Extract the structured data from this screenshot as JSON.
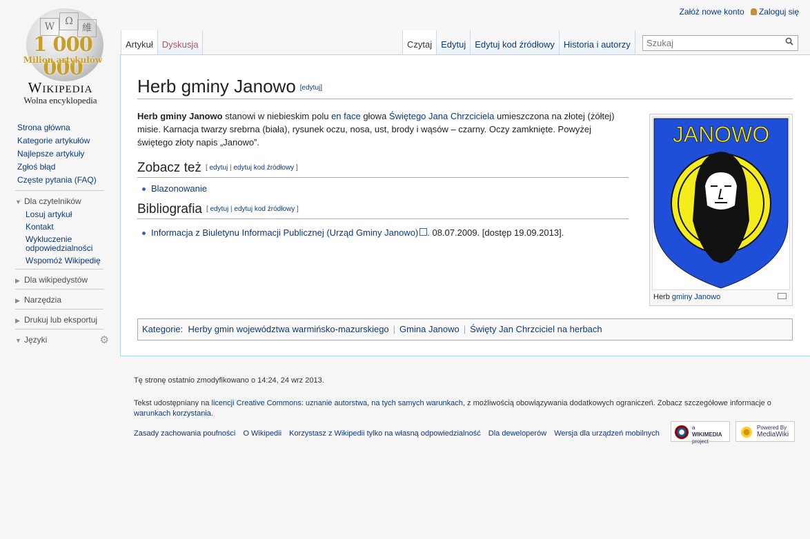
{
  "logo": {
    "million_number": "1 000 000",
    "million_text": "Milion artykułów",
    "wordmark": "Wikipedia",
    "slogan": "Wolna encyklopedia"
  },
  "personal": {
    "create_account": "Załóż nowe konto",
    "login": "Zaloguj się"
  },
  "left_tabs": [
    {
      "label": "Artykuł",
      "selected": true
    },
    {
      "label": "Dyskusja",
      "selected": false
    }
  ],
  "right_tabs": [
    {
      "label": "Czytaj",
      "selected": true
    },
    {
      "label": "Edytuj"
    },
    {
      "label": "Edytuj kod źródłowy"
    },
    {
      "label": "Historia i autorzy"
    }
  ],
  "search": {
    "placeholder": "Szukaj"
  },
  "sidebar": {
    "main": [
      "Strona główna",
      "Kategorie artykułów",
      "Najlepsze artykuły",
      "Zgłoś błąd",
      "Częste pytania (FAQ)"
    ],
    "readers": {
      "title": "Dla czytelników",
      "items": [
        "Losuj artykuł",
        "Kontakt",
        "Wykluczenie odpowiedzialności",
        "Wspomóż Wikipedię"
      ]
    },
    "wikipedians": "Dla wikipedystów",
    "tools": "Narzędzia",
    "print": "Drukuj lub eksportuj",
    "languages": "Języki"
  },
  "article": {
    "title": "Herb gminy Janowo",
    "edit": "[edytuj]",
    "intro_bold": "Herb gminy Janowo",
    "intro_1": " stanowi w niebieskim polu ",
    "link_enface": "en face",
    "intro_2": " głowa ",
    "link_saint": "Świętego Jana Chrzciciela",
    "intro_3": " umieszczona na złotej (żółtej) misie. Karnacja twarzy srebrna (biała), rysunek oczu, nosa, ust, brody i wąsów – czarny. Oczy zamknięte. Powyżej świętego złoty napis „Janowo”.",
    "section_edit_open": "[ ",
    "section_edit_a": "edytuj",
    "section_edit_sep": " | ",
    "section_edit_b": "edytuj kod źródłowy",
    "section_edit_close": " ]",
    "see_also": "Zobacz też",
    "see_also_item": "Blazonowanie",
    "bibliography": "Bibliografia",
    "bib_link": "Informacja z Biuletynu Informacji Publicznej (Urząd Gminy Janowo)",
    "bib_rest": ". 08.07.2009. [dostęp 19.09.2013]."
  },
  "thumb": {
    "caption_prefix": "Herb ",
    "caption_link": "gminy Janowo",
    "coat_text": "JANOWO",
    "colors": {
      "shield": "#1f4fd8",
      "disc": "#f5ec1c"
    }
  },
  "categories": {
    "label": "Kategorie",
    "items": [
      "Herby gmin województwa warmińsko-mazurskiego",
      "Gmina Janowo",
      "Święty Jan Chrzciciel na herbach"
    ]
  },
  "footer": {
    "modified": "Tę stronę ostatnio zmodyfikowano o 14:24, 24 wrz 2013.",
    "license_1": "Tekst udostępniany na ",
    "license_link": "licencji Creative Commons: uznanie autorstwa, na tych samych warunkach",
    "license_2": ", z możliwością obowiązywania dodatkowych ograniczeń. Zobacz szczegółowe informacje o ",
    "terms_link": "warunkach korzystania",
    "license_3": ".",
    "links": [
      "Zasady zachowania poufności",
      "O Wikipedii",
      "Korzystasz z Wikipedii tylko na własną odpowiedzialność",
      "Dla deweloperów",
      "Wersja dla urządzeń mobilnych"
    ],
    "badge1_small": "a",
    "badge1_main": "WIKIMEDIA",
    "badge1_sub": "project",
    "badge2_small": "Powered By",
    "badge2_main": "MediaWiki"
  }
}
